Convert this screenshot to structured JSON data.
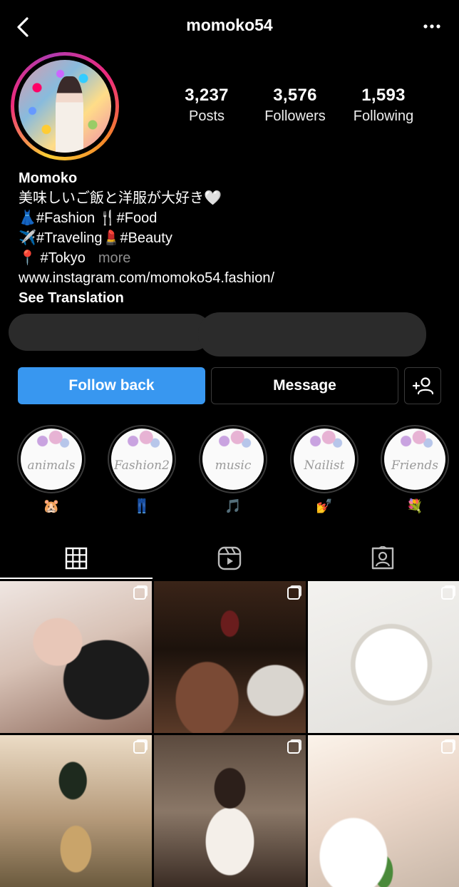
{
  "header": {
    "username": "momoko54"
  },
  "stats": [
    {
      "value": "3,237",
      "label": "Posts"
    },
    {
      "value": "3,576",
      "label": "Followers"
    },
    {
      "value": "1,593",
      "label": "Following"
    }
  ],
  "bio": {
    "name": "Momoko",
    "line1": "美味しいご飯と洋服が大好き🤍",
    "line2_emoji_a": "👗",
    "line2_a": "#Fashion",
    "line2_emoji_b": "🍴",
    "line2_b": "#Food",
    "line3_emoji_a": "✈️",
    "line3_a": "#Traveling",
    "line3_emoji_b": "💄",
    "line3_b": "#Beauty",
    "line4_emoji": "📍",
    "line4": "#Tokyo",
    "more": "more",
    "link": "www.instagram.com/momoko54.fashion/",
    "see_translation": "See Translation"
  },
  "actions": {
    "follow_back": "Follow back",
    "message": "Message"
  },
  "highlights": [
    {
      "label": "animals",
      "emoji": "🐹"
    },
    {
      "label": "Fashion2",
      "emoji": "👖"
    },
    {
      "label": "music",
      "emoji": "🎵"
    },
    {
      "label": "Nailist",
      "emoji": "💅"
    },
    {
      "label": "Friends",
      "emoji": "💐"
    }
  ],
  "tabs": [
    "grid-tab",
    "reels-tab",
    "tagged-tab"
  ],
  "colors": {
    "accent": "#3897f0",
    "background": "#000000"
  }
}
